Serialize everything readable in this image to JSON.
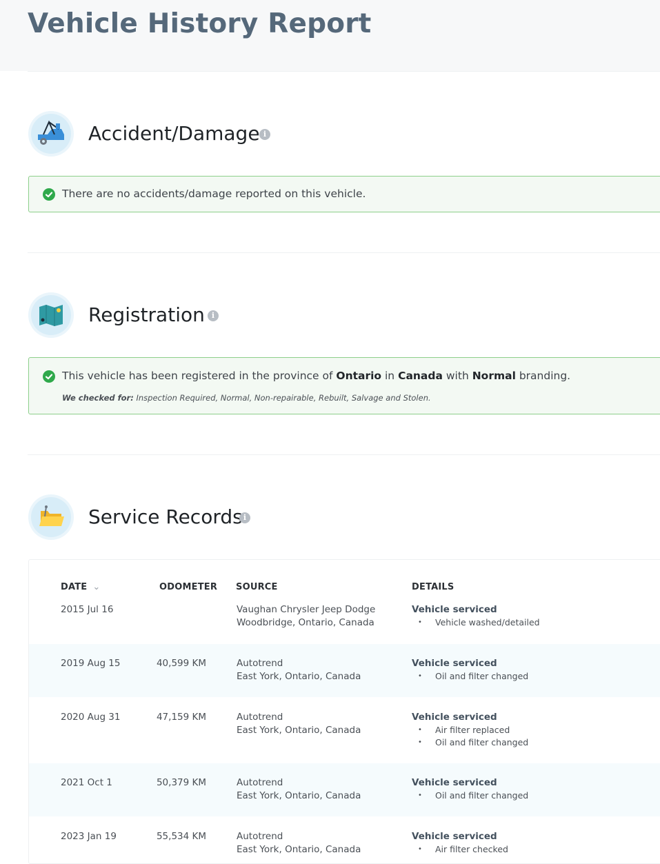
{
  "page": {
    "title": "Vehicle History Report"
  },
  "sections": {
    "accident": {
      "title": "Accident/Damage",
      "message": "There are no accidents/damage reported on this vehicle.",
      "icon": "tow-truck-icon"
    },
    "registration": {
      "title": "Registration",
      "message_prefix": "This vehicle has been registered in the province of ",
      "province": "Ontario",
      "in_word": " in ",
      "country": "Canada",
      "with_word": " with ",
      "branding": "Normal",
      "message_suffix": " branding.",
      "checked_label": "We checked for:",
      "checked_list": " Inspection Required, Normal, Non-repairable, Rebuilt, Salvage and Stolen.",
      "icon": "map-icon"
    },
    "service": {
      "title": "Service Records",
      "icon": "folder-icon",
      "columns": {
        "date": "DATE",
        "odometer": "ODOMETER",
        "source": "SOURCE",
        "details": "DETAILS"
      },
      "rows": [
        {
          "date": "2015 Jul 16",
          "odometer": "",
          "source_name": "Vaughan Chrysler Jeep Dodge",
          "source_location": "Woodbridge, Ontario, Canada",
          "detail_title": "Vehicle serviced",
          "items": [
            "Vehicle washed/detailed"
          ]
        },
        {
          "date": "2019 Aug 15",
          "odometer": "40,599 KM",
          "source_name": "Autotrend",
          "source_location": "East York, Ontario, Canada",
          "detail_title": "Vehicle serviced",
          "items": [
            "Oil and filter changed"
          ]
        },
        {
          "date": "2020 Aug 31",
          "odometer": "47,159 KM",
          "source_name": "Autotrend",
          "source_location": "East York, Ontario, Canada",
          "detail_title": "Vehicle serviced",
          "items": [
            "Air filter replaced",
            "Oil and filter changed"
          ]
        },
        {
          "date": "2021 Oct 1",
          "odometer": "50,379 KM",
          "source_name": "Autotrend",
          "source_location": "East York, Ontario, Canada",
          "detail_title": "Vehicle serviced",
          "items": [
            "Oil and filter changed"
          ]
        },
        {
          "date": "2023 Jan 19",
          "odometer": "55,534 KM",
          "source_name": "Autotrend",
          "source_location": "East York, Ontario, Canada",
          "detail_title": "Vehicle serviced",
          "items": [
            "Air filter checked"
          ]
        }
      ]
    }
  },
  "colors": {
    "success": "#2fa94b",
    "alert_bg": "#f3f9f3",
    "alert_border": "#8ccf8a",
    "title": "#55687a"
  }
}
